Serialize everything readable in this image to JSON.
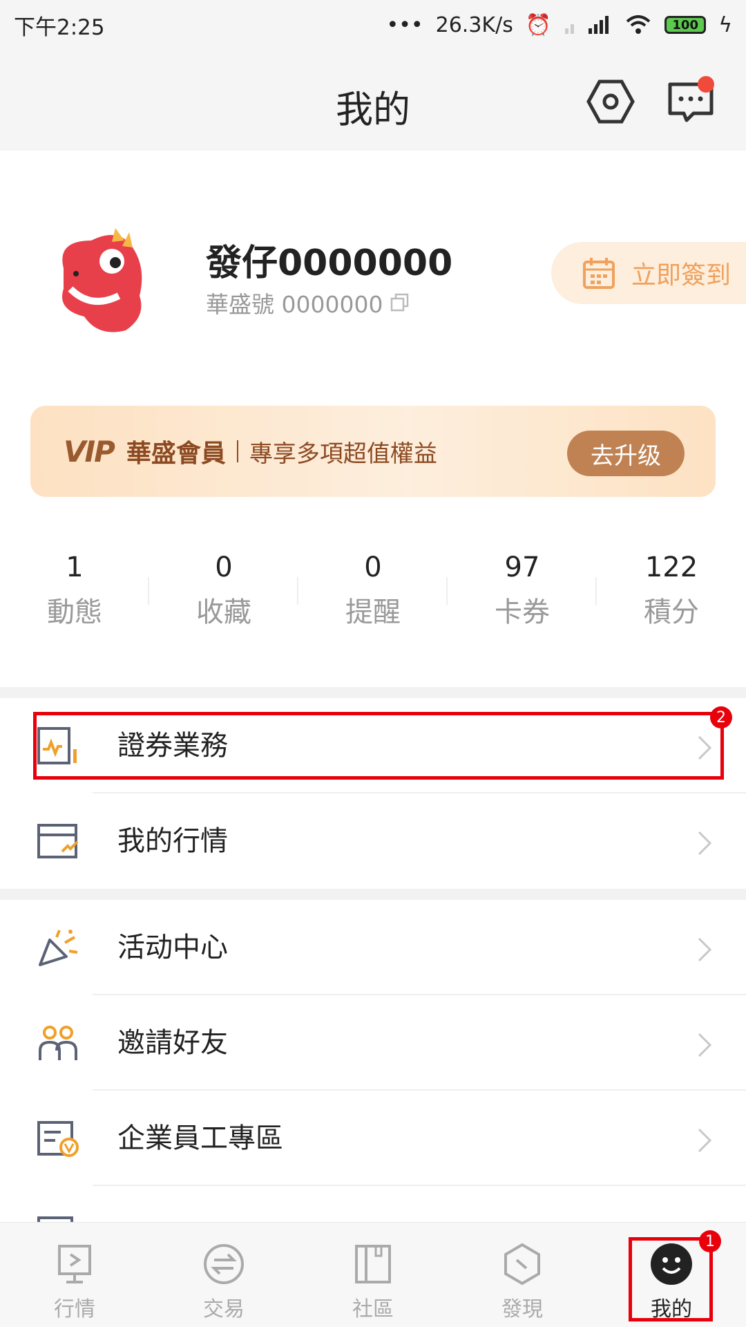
{
  "status_bar": {
    "time": "下午2:25",
    "network_speed": "26.3K/s",
    "battery": "100"
  },
  "header": {
    "title": "我的"
  },
  "profile": {
    "name": "發仔0000000",
    "id_text": "華盛號 0000000",
    "checkin_label": "立即簽到"
  },
  "vip": {
    "logo": "VIP",
    "title": "華盛會員",
    "description": "專享多項超值權益",
    "button_label": "去升级"
  },
  "stats": [
    {
      "value": "1",
      "label": "動態"
    },
    {
      "value": "0",
      "label": "收藏"
    },
    {
      "value": "0",
      "label": "提醒"
    },
    {
      "value": "97",
      "label": "卡券"
    },
    {
      "value": "122",
      "label": "積分"
    }
  ],
  "menu": [
    {
      "label": "證券業務",
      "icon": "securities-icon"
    },
    {
      "label": "我的行情",
      "icon": "quotes-card-icon"
    },
    {
      "label": "活动中心",
      "icon": "party-popper-icon"
    },
    {
      "label": "邀請好友",
      "icon": "invite-friends-icon"
    },
    {
      "label": "企業員工專區",
      "icon": "enterprise-icon"
    }
  ],
  "annotations": {
    "badge_1": "1",
    "badge_2": "2"
  },
  "tabbar": [
    {
      "label": "行情",
      "icon": "quotes-tab-icon"
    },
    {
      "label": "交易",
      "icon": "trade-tab-icon"
    },
    {
      "label": "社區",
      "icon": "community-tab-icon"
    },
    {
      "label": "發現",
      "icon": "discover-tab-icon"
    },
    {
      "label": "我的",
      "icon": "me-tab-icon"
    }
  ],
  "colors": {
    "accent_orange": "#f0a15c",
    "vip_brown": "#8c4a22",
    "highlight_red": "#e8000b"
  }
}
